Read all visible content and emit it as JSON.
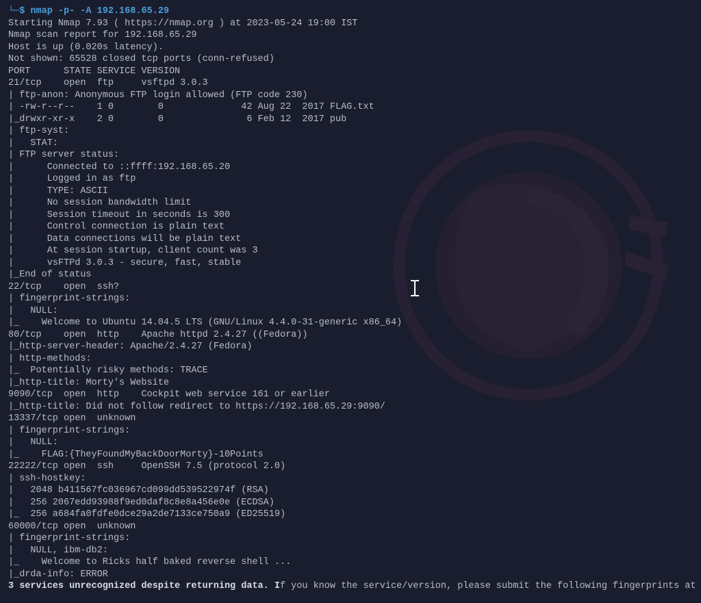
{
  "prompt": {
    "symbol": "└─$",
    "command": "nmap -p- -A 192.168.65.29"
  },
  "lines": [
    "Starting Nmap 7.93 ( https://nmap.org ) at 2023-05-24 19:00 IST",
    "Nmap scan report for 192.168.65.29",
    "Host is up (0.020s latency).",
    "Not shown: 65528 closed tcp ports (conn-refused)",
    "PORT      STATE SERVICE VERSION",
    "21/tcp    open  ftp     vsftpd 3.0.3",
    "| ftp-anon: Anonymous FTP login allowed (FTP code 230)",
    "| -rw-r--r--    1 0        0              42 Aug 22  2017 FLAG.txt",
    "|_drwxr-xr-x    2 0        0               6 Feb 12  2017 pub",
    "| ftp-syst:",
    "|   STAT:",
    "| FTP server status:",
    "|      Connected to ::ffff:192.168.65.20",
    "|      Logged in as ftp",
    "|      TYPE: ASCII",
    "|      No session bandwidth limit",
    "|      Session timeout in seconds is 300",
    "|      Control connection is plain text",
    "|      Data connections will be plain text",
    "|      At session startup, client count was 3",
    "|      vsFTPd 3.0.3 - secure, fast, stable",
    "|_End of status",
    "22/tcp    open  ssh?",
    "| fingerprint-strings:",
    "|   NULL:",
    "|_    Welcome to Ubuntu 14.04.5 LTS (GNU/Linux 4.4.0-31-generic x86_64)",
    "80/tcp    open  http    Apache httpd 2.4.27 ((Fedora))",
    "|_http-server-header: Apache/2.4.27 (Fedora)",
    "| http-methods:",
    "|_  Potentially risky methods: TRACE",
    "|_http-title: Morty's Website",
    "9090/tcp  open  http    Cockpit web service 161 or earlier",
    "|_http-title: Did not follow redirect to https://192.168.65.29:9090/",
    "13337/tcp open  unknown",
    "| fingerprint-strings:",
    "|   NULL:",
    "|_    FLAG:{TheyFoundMyBackDoorMorty}-10Points",
    "22222/tcp open  ssh     OpenSSH 7.5 (protocol 2.0)",
    "| ssh-hostkey:",
    "|   2048 b411567fc036967cd099dd539522974f (RSA)",
    "|   256 2067edd93988f9ed0daf8c8e8a456e0e (ECDSA)",
    "|_  256 a684fa0fdfe0dce29a2de7133ce750a9 (ED25519)",
    "60000/tcp open  unknown",
    "| fingerprint-strings:",
    "|   NULL, ibm-db2:",
    "|_    Welcome to Ricks half baked reverse shell ... ",
    "|_drda-info: ERROR"
  ],
  "last_line": {
    "bold_part": "3 services unrecognized despite returning data. I",
    "rest": "f you know the service/version, please submit the following fingerprints at"
  }
}
